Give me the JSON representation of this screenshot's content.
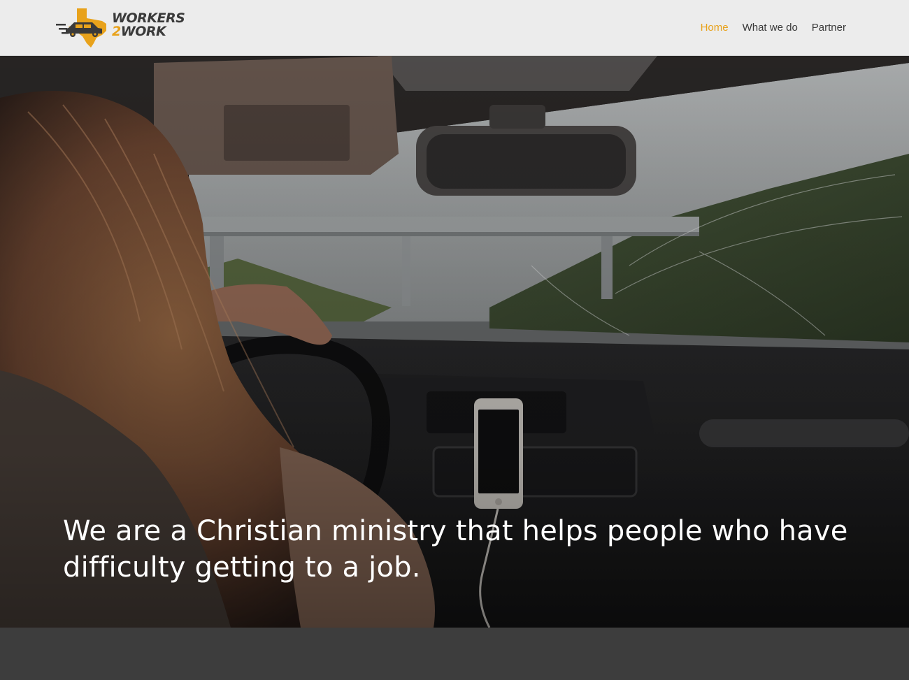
{
  "brand": {
    "line1": "WORKERS",
    "line2_num": "2",
    "line2_word": "WORK",
    "accent_color": "#e8a21b",
    "dark_color": "#3a3a3a",
    "mark_icon": "texas-car-icon"
  },
  "nav": {
    "items": [
      {
        "label": "Home",
        "active": true
      },
      {
        "label": "What we do",
        "active": false
      },
      {
        "label": "Partner",
        "active": false
      }
    ]
  },
  "hero": {
    "headline_line1": "We are a Christian ministry that helps people who have",
    "headline_line2": "difficulty getting to a job.",
    "image": "woman-driving-car-photo"
  }
}
